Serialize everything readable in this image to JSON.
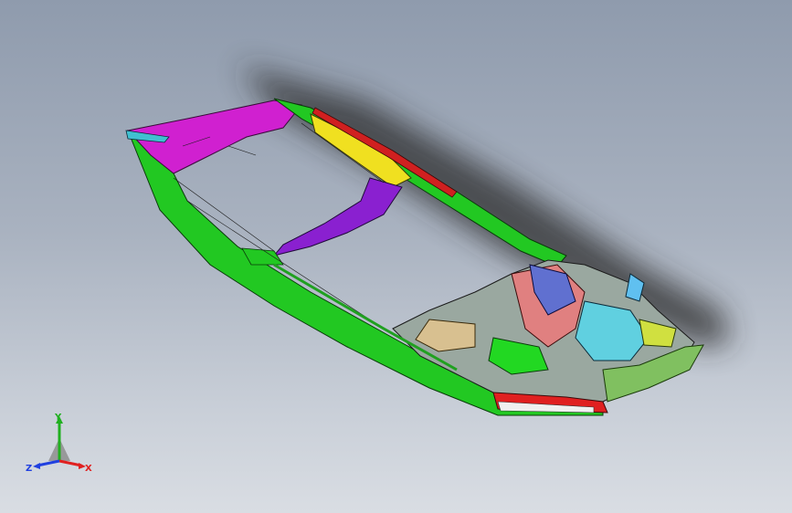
{
  "viewport": {
    "background_top": "#8f9bad",
    "background_bottom": "#d9dde3"
  },
  "model": {
    "icon": "car-body-floor-assembly-icon"
  },
  "triad": {
    "icon": "coordinate-triad-icon",
    "x_label": "X",
    "y_label": "Y",
    "z_label": "Z",
    "x_color": "#e02020",
    "y_color": "#20b020",
    "z_color": "#2040e0"
  }
}
